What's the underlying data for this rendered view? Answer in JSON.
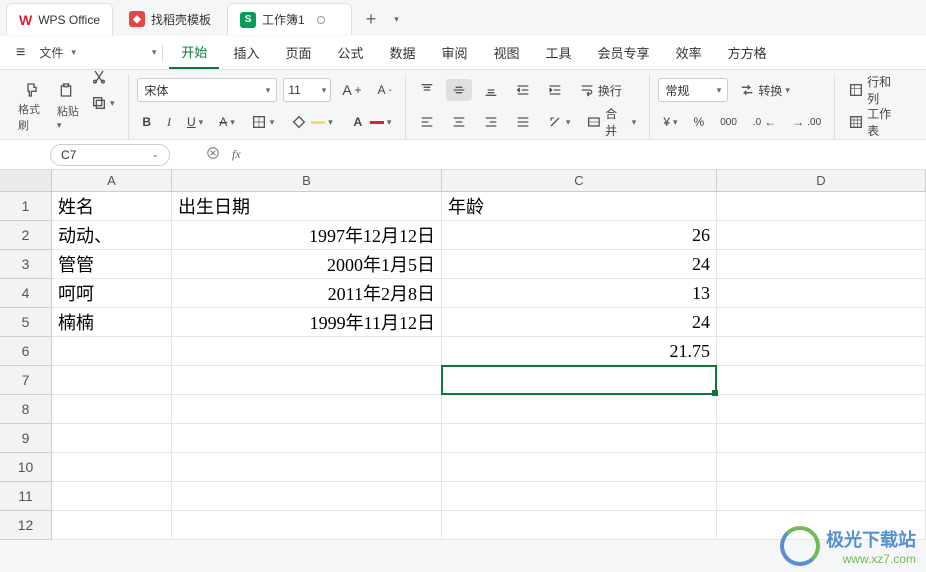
{
  "app": {
    "name": "WPS Office",
    "tabs": [
      {
        "label": "找稻壳模板",
        "icon_bg": "#e64545",
        "icon_text": ""
      },
      {
        "label": "工作簿1",
        "icon_bg": "#0a9c5a",
        "icon_text": "S",
        "active": true
      }
    ]
  },
  "menubar": {
    "file": "文件",
    "tabs": [
      "开始",
      "插入",
      "页面",
      "公式",
      "数据",
      "审阅",
      "视图",
      "工具",
      "会员专享",
      "效率",
      "方方格"
    ],
    "active_index": 0
  },
  "ribbon": {
    "format_painter": "格式刷",
    "paste": "粘贴",
    "font_name": "宋体",
    "font_size": "11",
    "bold": "B",
    "italic": "I",
    "underline": "U",
    "wrap": "换行",
    "merge": "合并",
    "numfmt": "常规",
    "convert": "转换",
    "rowcol": "行和列",
    "worksheet": "工作表"
  },
  "namebox": {
    "value": "C7"
  },
  "formula": {
    "label": "fx",
    "value": ""
  },
  "sheet": {
    "columns": [
      "A",
      "B",
      "C",
      "D"
    ],
    "rows": [
      {
        "n": "1",
        "A": "姓名",
        "B": "出生日期",
        "C": "年龄",
        "Balign": "left",
        "Calign": "left"
      },
      {
        "n": "2",
        "A": "动动、",
        "B": "1997年12月12日",
        "C": "26"
      },
      {
        "n": "3",
        "A": "管管",
        "B": "2000年1月5日",
        "C": "24"
      },
      {
        "n": "4",
        "A": "呵呵",
        "B": "2011年2月8日",
        "C": "13"
      },
      {
        "n": "5",
        "A": "楠楠",
        "B": "1999年11月12日",
        "C": "24"
      },
      {
        "n": "6",
        "A": "",
        "B": "",
        "C": "21.75"
      },
      {
        "n": "7",
        "A": "",
        "B": "",
        "C": ""
      },
      {
        "n": "8",
        "A": "",
        "B": "",
        "C": ""
      },
      {
        "n": "9",
        "A": "",
        "B": "",
        "C": ""
      },
      {
        "n": "10",
        "A": "",
        "B": "",
        "C": ""
      },
      {
        "n": "11",
        "A": "",
        "B": "",
        "C": ""
      },
      {
        "n": "12",
        "A": "",
        "B": "",
        "C": ""
      }
    ],
    "selected": "C7"
  },
  "watermark": {
    "text": "极光下载站",
    "url": "www.xz7.com"
  }
}
